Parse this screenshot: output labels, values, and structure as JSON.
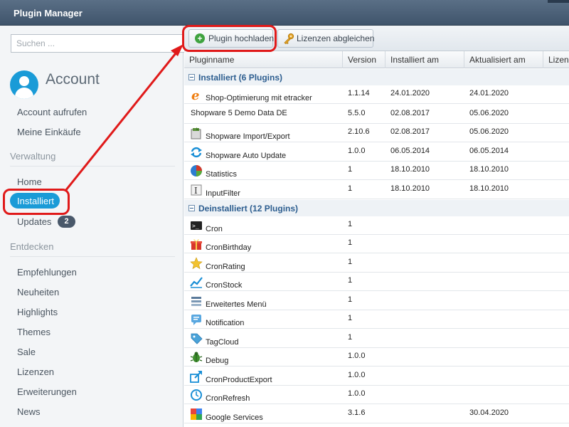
{
  "window": {
    "title": "Plugin Manager"
  },
  "sidebar": {
    "search_placeholder": "Suchen ...",
    "account_title": "Account",
    "account_links": [
      "Account aufrufen",
      "Meine Einkäufe"
    ],
    "section_verwaltung": "Verwaltung",
    "verwaltung_home": "Home",
    "verwaltung_installed": "Installiert",
    "verwaltung_updates": "Updates",
    "updates_badge": "2",
    "section_entdecken": "Entdecken",
    "entdecken_items": [
      "Empfehlungen",
      "Neuheiten",
      "Highlights",
      "Themes",
      "Sale",
      "Lizenzen",
      "Erweiterungen",
      "News"
    ]
  },
  "toolbar": {
    "upload_label": "Plugin hochladen",
    "license_label": "Lizenzen abgleichen"
  },
  "grid": {
    "columns": [
      "Pluginname",
      "Version",
      "Installiert am",
      "Aktualisiert am",
      "Lizenz"
    ],
    "groups": [
      {
        "label": "Installiert (6 Plugins)",
        "rows": [
          {
            "icon": "etracker-icon",
            "name": "Shop-Optimierung mit etracker",
            "version": "1.1.14",
            "installed": "24.01.2020",
            "updated": "24.01.2020"
          },
          {
            "icon": "",
            "name": "Shopware 5 Demo Data DE",
            "version": "5.5.0",
            "installed": "02.08.2017",
            "updated": "05.06.2020"
          },
          {
            "icon": "import-export-icon",
            "name": "Shopware Import/Export",
            "version": "2.10.6",
            "installed": "02.08.2017",
            "updated": "05.06.2020"
          },
          {
            "icon": "auto-update-icon",
            "name": "Shopware Auto Update",
            "version": "1.0.0",
            "installed": "06.05.2014",
            "updated": "06.05.2014"
          },
          {
            "icon": "statistics-icon",
            "name": "Statistics",
            "version": "1",
            "installed": "18.10.2010",
            "updated": "18.10.2010"
          },
          {
            "icon": "input-filter-icon",
            "name": "InputFilter",
            "version": "1",
            "installed": "18.10.2010",
            "updated": "18.10.2010"
          }
        ]
      },
      {
        "label": "Deinstalliert (12 Plugins)",
        "rows": [
          {
            "icon": "terminal-icon",
            "name": "Cron",
            "version": "1",
            "installed": "",
            "updated": ""
          },
          {
            "icon": "gift-icon",
            "name": "CronBirthday",
            "version": "1",
            "installed": "",
            "updated": ""
          },
          {
            "icon": "star-icon",
            "name": "CronRating",
            "version": "1",
            "installed": "",
            "updated": ""
          },
          {
            "icon": "stock-chart-icon",
            "name": "CronStock",
            "version": "1",
            "installed": "",
            "updated": ""
          },
          {
            "icon": "menu-icon",
            "name": "Erweitertes Menü",
            "version": "1",
            "installed": "",
            "updated": ""
          },
          {
            "icon": "notification-icon",
            "name": "Notification",
            "version": "1",
            "installed": "",
            "updated": ""
          },
          {
            "icon": "tag-icon",
            "name": "TagCloud",
            "version": "1",
            "installed": "",
            "updated": ""
          },
          {
            "icon": "bug-icon",
            "name": "Debug",
            "version": "1.0.0",
            "installed": "",
            "updated": ""
          },
          {
            "icon": "export-icon",
            "name": "CronProductExport",
            "version": "1.0.0",
            "installed": "",
            "updated": ""
          },
          {
            "icon": "refresh-clock-icon",
            "name": "CronRefresh",
            "version": "1.0.0",
            "installed": "",
            "updated": ""
          },
          {
            "icon": "google-icon",
            "name": "Google Services",
            "version": "3.1.6",
            "installed": "",
            "updated": "30.04.2020"
          }
        ]
      }
    ]
  }
}
